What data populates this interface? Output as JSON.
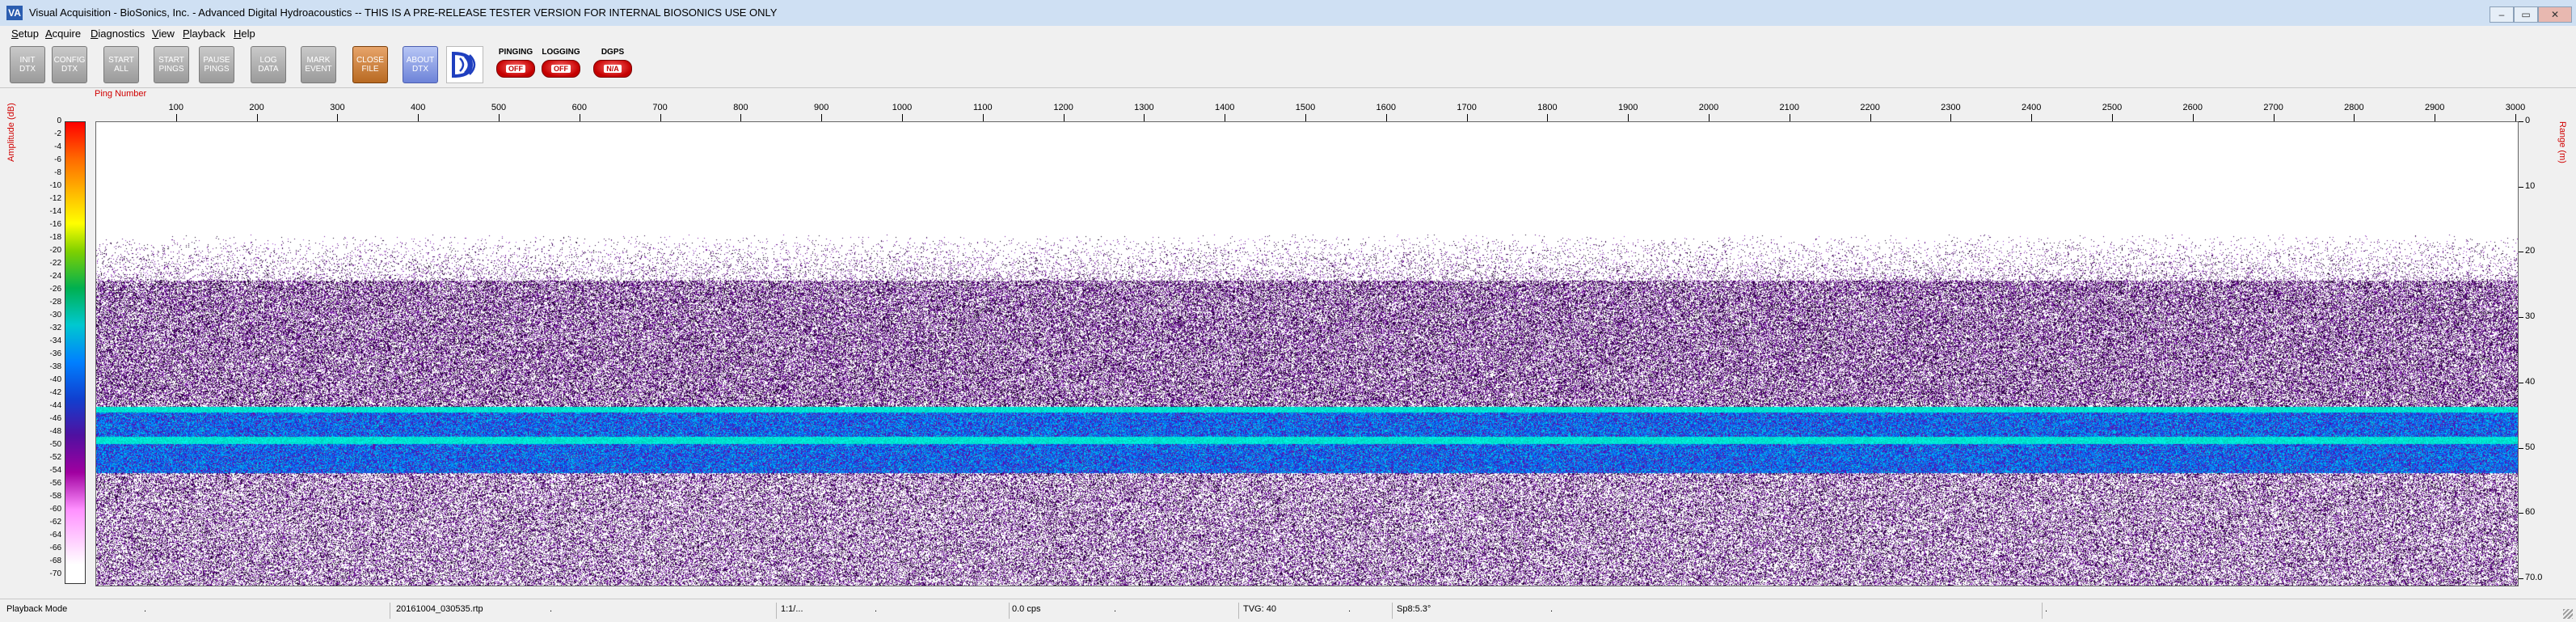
{
  "window": {
    "title": "Visual Acquisition  -  BioSonics, Inc.  -  Advanced Digital Hydroacoustics  -- THIS IS A PRE-RELEASE TESTER VERSION FOR INTERNAL BIOSONICS USE ONLY",
    "app_icon_text": "VA",
    "minimize": "–",
    "maximize": "▭",
    "close": "✕"
  },
  "menu": [
    "Setup",
    "Acquire",
    "Diagnostics",
    "View",
    "Playback",
    "Help"
  ],
  "toolbar": {
    "buttons": [
      {
        "label": "INIT DTX",
        "style": "grey"
      },
      {
        "label": "CONFIG DTX",
        "style": "grey"
      },
      {
        "label": "START ALL",
        "style": "grey"
      },
      {
        "label": "START PINGS",
        "style": "grey"
      },
      {
        "label": "PAUSE PINGS",
        "style": "grey"
      },
      {
        "label": "LOG DATA",
        "style": "grey"
      },
      {
        "label": "MARK EVENT",
        "style": "grey"
      },
      {
        "label": "CLOSE FILE",
        "style": "orange"
      },
      {
        "label": "ABOUT DTX",
        "style": "blue"
      }
    ],
    "status": [
      {
        "label": "PINGING",
        "value": "OFF"
      },
      {
        "label": "LOGGING",
        "value": "OFF"
      },
      {
        "label": "DGPS",
        "value": "N/A"
      }
    ]
  },
  "echogram": {
    "ping_axis_label": "Ping Number",
    "amplitude_label": "Amplitude (dB)",
    "range_label": "Range (m)",
    "ping_ticks": [
      100,
      200,
      300,
      400,
      500,
      600,
      700,
      800,
      900,
      1000,
      1100,
      1200,
      1300,
      1400,
      1500,
      1600,
      1700,
      1800,
      1900,
      2000,
      2100,
      2200,
      2300,
      2400,
      2500,
      2600,
      2700,
      2800,
      2900,
      3000
    ],
    "ping_max": 3000,
    "range_ticks": [
      "0",
      "10",
      "20",
      "30",
      "40",
      "50",
      "60",
      "70.0"
    ],
    "range_max_m": 70,
    "colorbar_ticks": [
      "0",
      "-2",
      "-4",
      "-6",
      "-8",
      "-10",
      "-12",
      "-14",
      "-16",
      "-18",
      "-20",
      "-22",
      "-24",
      "-26",
      "-28",
      "-30",
      "-32",
      "-34",
      "-36",
      "-38",
      "-40",
      "-42",
      "-44",
      "-46",
      "-48",
      "-50",
      "-52",
      "-54",
      "-56",
      "-58",
      "-60",
      "-62",
      "-64",
      "-66",
      "-68",
      "-70"
    ],
    "layers": {
      "surface_noise_start_m": 17,
      "noise_band_start_m": 24,
      "bottom_band_start_m": 43,
      "bottom_band_end_m": 53,
      "sub_bottom_end_m": 70
    }
  },
  "statusbar": {
    "mode": "Playback Mode",
    "file": "20161004_030535.rtp",
    "ratio": "1:1/...",
    "rate": "0.0 cps",
    "tvg": "TVG: 40",
    "sp": "Sp8:5.3°",
    "dot": "."
  }
}
